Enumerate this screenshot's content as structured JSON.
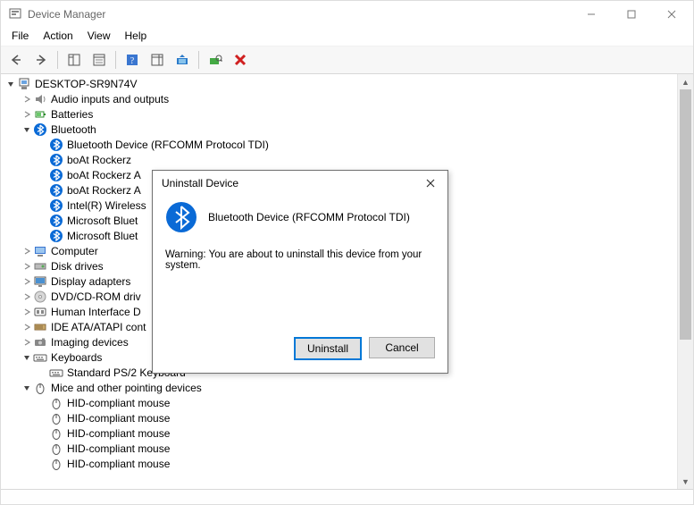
{
  "window": {
    "title": "Device Manager"
  },
  "menu": [
    "File",
    "Action",
    "View",
    "Help"
  ],
  "tree": {
    "root": "DESKTOP-SR9N74V",
    "items": [
      {
        "icon": "audio",
        "expand": "closed",
        "label": "Audio inputs and outputs"
      },
      {
        "icon": "battery",
        "expand": "closed",
        "label": "Batteries"
      },
      {
        "icon": "bluetooth",
        "expand": "open",
        "label": "Bluetooth",
        "children": [
          {
            "icon": "bluetooth",
            "label": "Bluetooth Device (RFCOMM Protocol TDI)"
          },
          {
            "icon": "bluetooth",
            "label": "boAt Rockerz"
          },
          {
            "icon": "bluetooth",
            "label": "boAt Rockerz A"
          },
          {
            "icon": "bluetooth",
            "label": "boAt Rockerz A"
          },
          {
            "icon": "bluetooth",
            "label": "Intel(R) Wireless"
          },
          {
            "icon": "bluetooth",
            "label": "Microsoft Bluet"
          },
          {
            "icon": "bluetooth",
            "label": "Microsoft Bluet"
          }
        ]
      },
      {
        "icon": "computer",
        "expand": "closed",
        "label": "Computer"
      },
      {
        "icon": "disk",
        "expand": "closed",
        "label": "Disk drives"
      },
      {
        "icon": "display",
        "expand": "closed",
        "label": "Display adapters"
      },
      {
        "icon": "dvd",
        "expand": "closed",
        "label": "DVD/CD-ROM driv"
      },
      {
        "icon": "hid",
        "expand": "closed",
        "label": "Human Interface D"
      },
      {
        "icon": "ide",
        "expand": "closed",
        "label": "IDE ATA/ATAPI cont"
      },
      {
        "icon": "imaging",
        "expand": "closed",
        "label": "Imaging devices"
      },
      {
        "icon": "keyboard",
        "expand": "open",
        "label": "Keyboards",
        "children": [
          {
            "icon": "keyboard",
            "label": "Standard PS/2 Keyboard"
          }
        ]
      },
      {
        "icon": "mouse",
        "expand": "open",
        "label": "Mice and other pointing devices",
        "children": [
          {
            "icon": "mouse",
            "label": "HID-compliant mouse"
          },
          {
            "icon": "mouse",
            "label": "HID-compliant mouse"
          },
          {
            "icon": "mouse",
            "label": "HID-compliant mouse"
          },
          {
            "icon": "mouse",
            "label": "HID-compliant mouse"
          },
          {
            "icon": "mouse",
            "label": "HID-compliant mouse"
          }
        ]
      }
    ]
  },
  "dialog": {
    "title": "Uninstall Device",
    "device": "Bluetooth Device (RFCOMM Protocol TDI)",
    "warning": "Warning: You are about to uninstall this device from your system.",
    "uninstall_label": "Uninstall",
    "cancel_label": "Cancel"
  }
}
